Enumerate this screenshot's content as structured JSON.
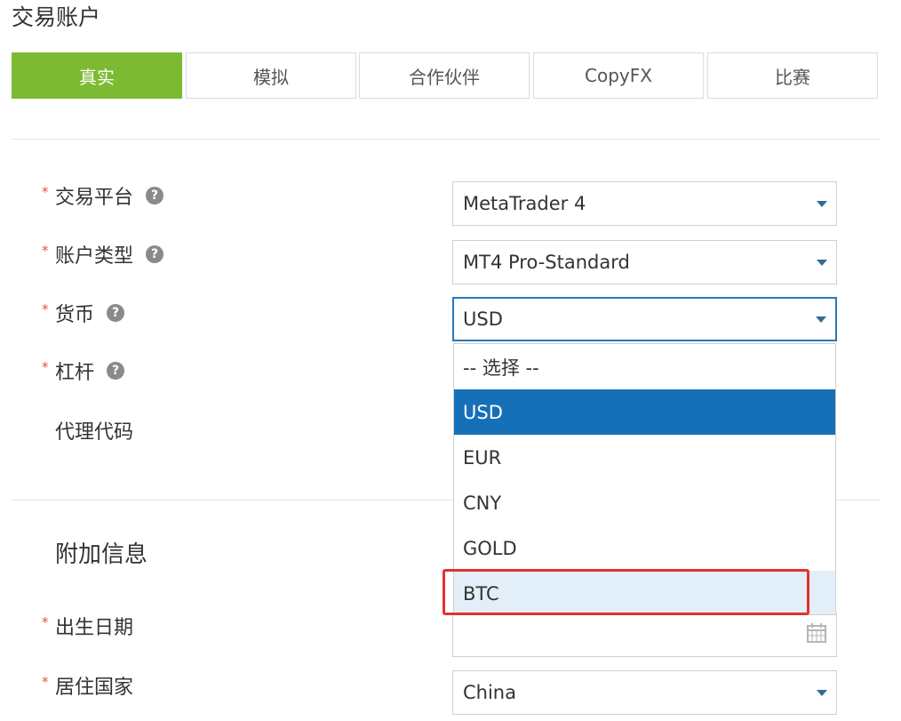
{
  "page": {
    "title": "交易账户"
  },
  "tabs": [
    {
      "label": "真实",
      "active": true
    },
    {
      "label": "模拟",
      "active": false
    },
    {
      "label": "合作伙伴",
      "active": false
    },
    {
      "label": "CopyFX",
      "active": false
    },
    {
      "label": "比赛",
      "active": false
    }
  ],
  "colors": {
    "accent_green": "#7cbb31",
    "selected_blue": "#1570b8",
    "focus_blue": "#2b78b8",
    "highlight_red": "#e33030",
    "required_star": "#d9534f"
  },
  "icons": {
    "help": "question-circle-icon",
    "dropdown": "caret-down-icon",
    "calendar": "calendar-icon"
  },
  "form": {
    "platform": {
      "label": "交易平台",
      "value": "MetaTrader 4"
    },
    "account_type": {
      "label": "账户类型",
      "value": "MT4 Pro-Standard"
    },
    "currency": {
      "label": "货币",
      "value": "USD"
    },
    "leverage": {
      "label": "杠杆"
    },
    "agent_code": {
      "label": "代理代码"
    }
  },
  "currency_dropdown": {
    "options": [
      "-- 选择 --",
      "USD",
      "EUR",
      "CNY",
      "GOLD",
      "BTC"
    ],
    "selected": "USD",
    "hovered": "BTC"
  },
  "additional": {
    "title": "附加信息",
    "birth_date": {
      "label": "出生日期",
      "value": ""
    },
    "country": {
      "label": "居住国家",
      "value": "China"
    }
  }
}
